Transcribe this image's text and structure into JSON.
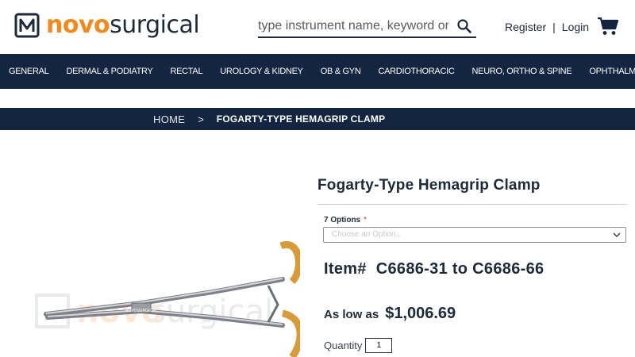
{
  "brand": {
    "prefix": "novo",
    "suffix": "surgical"
  },
  "search": {
    "placeholder": "type instrument name, keyword or item #"
  },
  "account": {
    "register": "Register",
    "separator": "|",
    "login": "Login"
  },
  "nav": {
    "items": [
      {
        "label": "GENERAL"
      },
      {
        "label": "DERMAL & PODIATRY"
      },
      {
        "label": "RECTAL"
      },
      {
        "label": "UROLOGY & KIDNEY"
      },
      {
        "label": "OB & GYN"
      },
      {
        "label": "CARDIOTHORACIC"
      },
      {
        "label": "NEURO, ORTHO & SPINE"
      },
      {
        "label": "OPHTHALMOLOGY"
      }
    ]
  },
  "breadcrumb": {
    "home": "HOME",
    "separator": ">",
    "current": "FOGARTY-TYPE HEMAGRIP CLAMP"
  },
  "product": {
    "title": "Fogarty-Type Hemagrip Clamp",
    "options_label": "7 Options",
    "options_required": "*",
    "options_selected": "Choose an Option...",
    "item_label": "Item#",
    "item_range": "C6686-31 to C6686-66",
    "price_label": "As low as",
    "price": "$1,006.69",
    "quantity_label": "Quantity",
    "quantity_value": "1",
    "instrument_engraving": "NOVOSURGICAL"
  },
  "colors": {
    "navy": "#142541",
    "brand_orange": "#f08a1c",
    "gold": "#d99a3a"
  }
}
